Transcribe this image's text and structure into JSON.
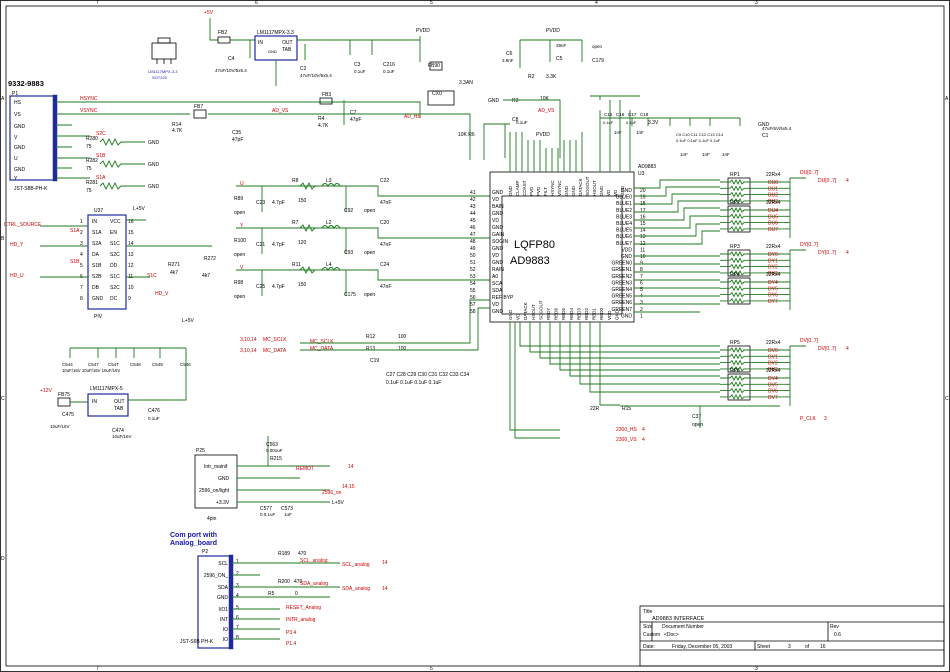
{
  "sheet": {
    "border_cols": [
      "7",
      "6",
      "5",
      "4",
      "3",
      "2",
      "1"
    ],
    "border_rows": [
      "A",
      "B",
      "C",
      "D",
      "E"
    ]
  },
  "connector_p1": {
    "title": "9332-9883",
    "ref": "P1",
    "part": "JST-S8B-PH-K",
    "pins": [
      "HS",
      "VS",
      "GND",
      "V",
      "GND",
      "U",
      "GND",
      "Y"
    ],
    "nets": [
      "HSYNC",
      "VSYNC"
    ]
  },
  "resistors_left": [
    {
      "ref": "R280",
      "val": "75",
      "net": "S2C"
    },
    {
      "ref": "R282",
      "val": "75",
      "net": "S1B"
    },
    {
      "ref": "R281",
      "val": "75",
      "net": "S1A"
    }
  ],
  "u37": {
    "ref": "U37",
    "part": "PIV",
    "left_pins": [
      "IN",
      "S1A",
      "S2A",
      "DA",
      "S1B",
      "S2B",
      "DB",
      "GND"
    ],
    "right_pins": [
      "VCC",
      "EN",
      "S1C",
      "S2C",
      "DD",
      "S1C",
      "S2C",
      "DC"
    ],
    "left_nums": [
      "1",
      "2",
      "3",
      "4",
      "5",
      "6",
      "7",
      "8"
    ],
    "right_nums": [
      "16",
      "15",
      "14",
      "13",
      "12",
      "11",
      "10",
      "9"
    ],
    "sigs": [
      "CTRL_SOURCE",
      "HD_Y",
      "HD_U",
      "S1A",
      "S1B",
      "S1C",
      "HD_V"
    ],
    "supply": "L+5V"
  },
  "regulator_top": {
    "ref": "LM1117MPX-3.3",
    "u": "U1",
    "fb": "FB2",
    "cap1": "C4",
    "cap1val": "47uF/10V/5x5.4",
    "cap2": "C2",
    "cap2val": "47uF/10V/5x5.4",
    "in": "IN",
    "out": "OUT",
    "tab": "TAB",
    "gnd": "GND",
    "rail": "+5V"
  },
  "regulator_bot": {
    "ref": "LM1117MPX-5",
    "u": "U36",
    "fb": "FB75",
    "rail": "+12V",
    "cap1": "C475",
    "cap1val": "10uF/16V",
    "cap2": "C474",
    "cap2val": "10uF/16V",
    "c476": "C476",
    "c476v": "0.1uF",
    "in": "IN",
    "out": "OUT",
    "tab": "TAB"
  },
  "caps_mid_left": [
    "C544",
    "C547",
    "C54T",
    "C548",
    "C549",
    "C546"
  ],
  "caps_mid_left_val": "10uF/16V 10uF/16V 10uF/16V",
  "pvdd": {
    "label": "PVDD",
    "fb": "FB90",
    "fbnote": "3.3AN",
    "cx": "CX0",
    "c6": "C6",
    "c6v": "3.9nF",
    "c5": "C5",
    "c5v": "39nF",
    "c179": "C179",
    "open": "open",
    "r2": "R2",
    "r2v": "3.3K",
    "r3": "R3",
    "r3v": "10K",
    "adv": "AD_VS",
    "adh": "AD_HS"
  },
  "ad9883": {
    "chip": "AD9883",
    "pkg": "LQFP80",
    "ref": "U3",
    "left_pins": [
      "GND",
      "VD",
      "BAIN",
      "GND",
      "VD",
      "GND",
      "GAIN",
      "SOGIN",
      "GND",
      "VD",
      "GND",
      "RAIN",
      "A0",
      "SCA",
      "SDA",
      "REF BYP",
      "VD",
      "GND"
    ],
    "left_nums": [
      "41",
      "42",
      "43",
      "44",
      "45",
      "46",
      "47",
      "48",
      "49",
      "50",
      "51",
      "52",
      "53",
      "54",
      "55",
      "56",
      "57",
      "58",
      "59",
      "60"
    ],
    "right_pins": [
      "GND",
      "BLUE0",
      "BLUE1",
      "BLUE2",
      "BLUE3",
      "BLUE4",
      "BLUE5",
      "BLUE6",
      "BLUE7",
      "VDD",
      "GND",
      "GREEN0",
      "GREEN1",
      "GREEN2",
      "GREEN3",
      "GREEN4",
      "GREEN5",
      "GREEN6",
      "GREEN7",
      "GND"
    ],
    "right_nums": [
      "20",
      "19",
      "18",
      "17",
      "16",
      "15",
      "14",
      "13",
      "12",
      "11",
      "10",
      "9",
      "8",
      "7",
      "6",
      "5",
      "4",
      "3",
      "2",
      "1"
    ],
    "top_pins": [
      "GND",
      "CLAMP",
      "COAST",
      "PVD",
      "PVD",
      "FILT",
      "HSYNC",
      "VSYNC",
      "GND",
      "GND",
      "DATACK",
      "SOGOUT",
      "HSOUT",
      "GND",
      "VD",
      "VD",
      "GND"
    ],
    "bottom_pins": [
      "GND",
      "VD",
      "DATACK",
      "HSOUT",
      "SOGOUT",
      "RED7",
      "RED6",
      "RED5",
      "RED4",
      "RED3",
      "RED2",
      "RED1",
      "RED0",
      "VDD",
      "GND"
    ]
  },
  "rgb_inputs": [
    {
      "net": "U",
      "r": "R8",
      "rv": "150",
      "l": "L3",
      "c": "C22",
      "cv": "47nF",
      "c2": "C23",
      "c2v": "4.7pF",
      "r2": "R89",
      "cop": "C92",
      "open": "open"
    },
    {
      "net": "Y",
      "r": "R7",
      "rv": "120",
      "l": "L2",
      "c": "C20",
      "cv": "47nF",
      "c2": "C21",
      "c2v": "4.7pF",
      "r2": "R100",
      "cop": "C93",
      "open": "open"
    },
    {
      "net": "V",
      "r": "R11",
      "rv": "150",
      "l": "L4",
      "c": "C24",
      "cv": "47nF",
      "c2": "C25",
      "c2v": "4.7pF",
      "r2": "R98",
      "cop": "C175",
      "open": "open"
    }
  ],
  "mc_bus": [
    {
      "net": "MC_SCLK",
      "sheet": "3,10,14",
      "r": "R12",
      "rv": "100"
    },
    {
      "net": "MC_DATA",
      "sheet": "3,10,14",
      "r": "R13",
      "rv": "100"
    }
  ],
  "rps": [
    {
      "ref": "RP1",
      "val": "22Rx4",
      "nets": [
        "DU0",
        "DU1",
        "DU2",
        "DU3"
      ],
      "bus": "DU[0..7]",
      "page": "4"
    },
    {
      "ref": "RP2",
      "val": "22Rx4",
      "nets": [
        "DU4",
        "DU5",
        "DU6",
        "DU7"
      ]
    },
    {
      "ref": "RP3",
      "val": "22Rx4",
      "nets": [
        "DY0",
        "DY1",
        "DY2",
        "DY3"
      ],
      "bus": "DY[0..7]",
      "page": "4"
    },
    {
      "ref": "RP4",
      "val": "22Rx4",
      "nets": [
        "DY4",
        "DY5",
        "DY6",
        "DY7"
      ]
    },
    {
      "ref": "RP5",
      "val": "22Rx4",
      "nets": [
        "DV0",
        "DV1",
        "DV2",
        "DV3"
      ],
      "bus": "DV[0..7]",
      "page": "4"
    },
    {
      "ref": "RP6",
      "val": "22Rx4",
      "nets": [
        "DV4",
        "DV5",
        "DV6",
        "DV7"
      ]
    }
  ],
  "right_caps": {
    "c15": "C15",
    "c16": "C16",
    "c17": "C17",
    "c18": "C18",
    "val": "0.1uF",
    "c1": "C1",
    "c1v": "47uF/6V/5x5.4",
    "rail": "3.3V",
    "c1nf": "1nF"
  },
  "bottom_outs": [
    {
      "net": "P_CLK",
      "page": "3",
      "r": "R15",
      "rv": "22R"
    },
    {
      "net": "2300_HS",
      "page": "4"
    },
    {
      "net": "2300_VS",
      "page": "4"
    }
  ],
  "c37": {
    "ref": "C37",
    "val": "open"
  },
  "p25": {
    "ref": "P25",
    "part": "4pin",
    "pins": [
      "Intr_mainif",
      "GND",
      "2596_on/light",
      "+3.3V"
    ],
    "nets": [
      "REMOT",
      "2596_on",
      "L+5V"
    ],
    "pages": [
      "14",
      "14,15"
    ],
    "r215": "R215",
    "c563": "C563",
    "c563v": "0.001uF",
    "c577": "C577",
    "c577v": "0.0.1uF",
    "c573": "C573",
    "c573v": "1uF"
  },
  "p2": {
    "heading1": "Com port with",
    "heading2": "Analog_board",
    "ref": "P2",
    "part": "JST-S6B PH-K",
    "pins": [
      "SCL",
      "2596_ON_",
      "SDA",
      "GND",
      "I/O1",
      "INT",
      "IO",
      "IO"
    ],
    "nets": [
      "SCL_analog",
      "SDA_analog",
      "RESET_Analog",
      "INTR_analog",
      "P3.4",
      "P1.4"
    ],
    "r189": "R189",
    "r189v": "470",
    "r200": "R200",
    "r200v": "470",
    "r5": "R5",
    "r5v": "0",
    "page": "14"
  },
  "title_block": {
    "title_label": "Title",
    "title": "AD9883 INTERFACE",
    "size_label": "Size",
    "size": "Custom",
    "docnum_label": "Document Number",
    "docnum": "<Doc>",
    "rev_label": "Rev",
    "rev": "0.6",
    "date_label": "Date:",
    "date": "Friday, December 05, 2003",
    "sheet_label": "Sheet",
    "sheet": "3",
    "of_label": "of",
    "of": "16"
  },
  "pkg_label": {
    "a": "LM1117MPX-3.3",
    "b": "SOT223"
  }
}
